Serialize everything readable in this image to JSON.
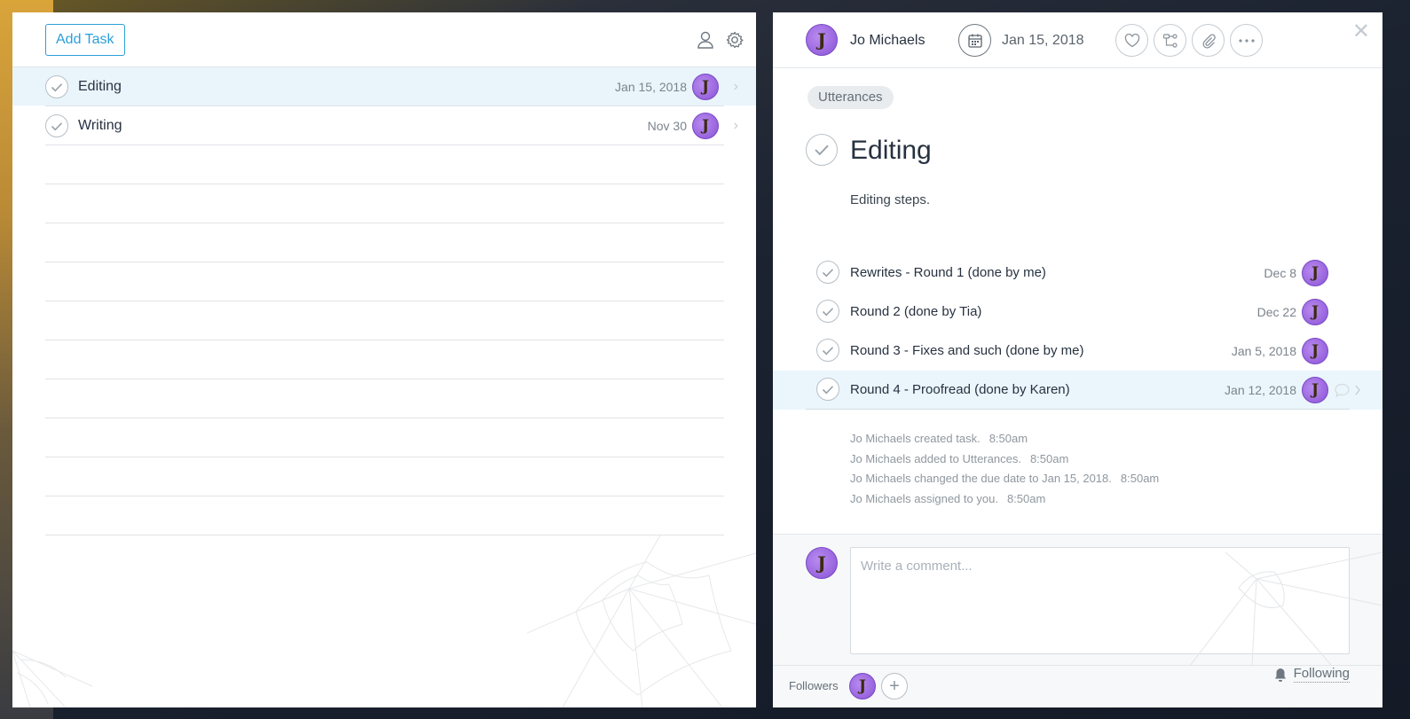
{
  "list": {
    "add_task_label": "Add Task",
    "tasks": [
      {
        "name": "Editing",
        "date": "Jan 15, 2018",
        "selected": true
      },
      {
        "name": "Writing",
        "date": "Nov 30",
        "selected": false
      }
    ]
  },
  "avatar_initial": "J",
  "detail": {
    "assignee": "Jo Michaels",
    "due_date": "Jan 15, 2018",
    "project_tag": "Utterances",
    "title": "Editing",
    "description": "Editing steps.",
    "subtasks": [
      {
        "name": "Rewrites - Round 1 (done by me)",
        "date": "Dec 8"
      },
      {
        "name": "Round 2 (done by Tia)",
        "date": "Dec 22"
      },
      {
        "name": "Round 3 - Fixes and such (done by me)",
        "date": "Jan 5, 2018"
      },
      {
        "name": "Round 4 - Proofread (done by Karen)",
        "date": "Jan 12, 2018"
      }
    ],
    "activity": [
      {
        "text": "Jo Michaels created task.",
        "time": "8:50am"
      },
      {
        "text": "Jo Michaels added to Utterances.",
        "time": "8:50am"
      },
      {
        "text": "Jo Michaels changed the due date to Jan 15, 2018.",
        "time": "8:50am"
      },
      {
        "text": "Jo Michaels assigned to you.",
        "time": "8:50am"
      }
    ],
    "comment_placeholder": "Write a comment...",
    "followers_label": "Followers",
    "following_label": "Following"
  },
  "icons": {
    "user": "user-icon",
    "settings": "gear-icon",
    "calendar": "calendar-icon",
    "like": "heart-icon",
    "subtask": "subtask-icon",
    "attach": "paperclip-icon",
    "more": "more-icon",
    "close": "close-icon",
    "bell": "bell-icon"
  },
  "colors": {
    "accent": "#2b9fd9",
    "selected_row": "#e9f5fb",
    "avatar": "#9b63e0"
  }
}
